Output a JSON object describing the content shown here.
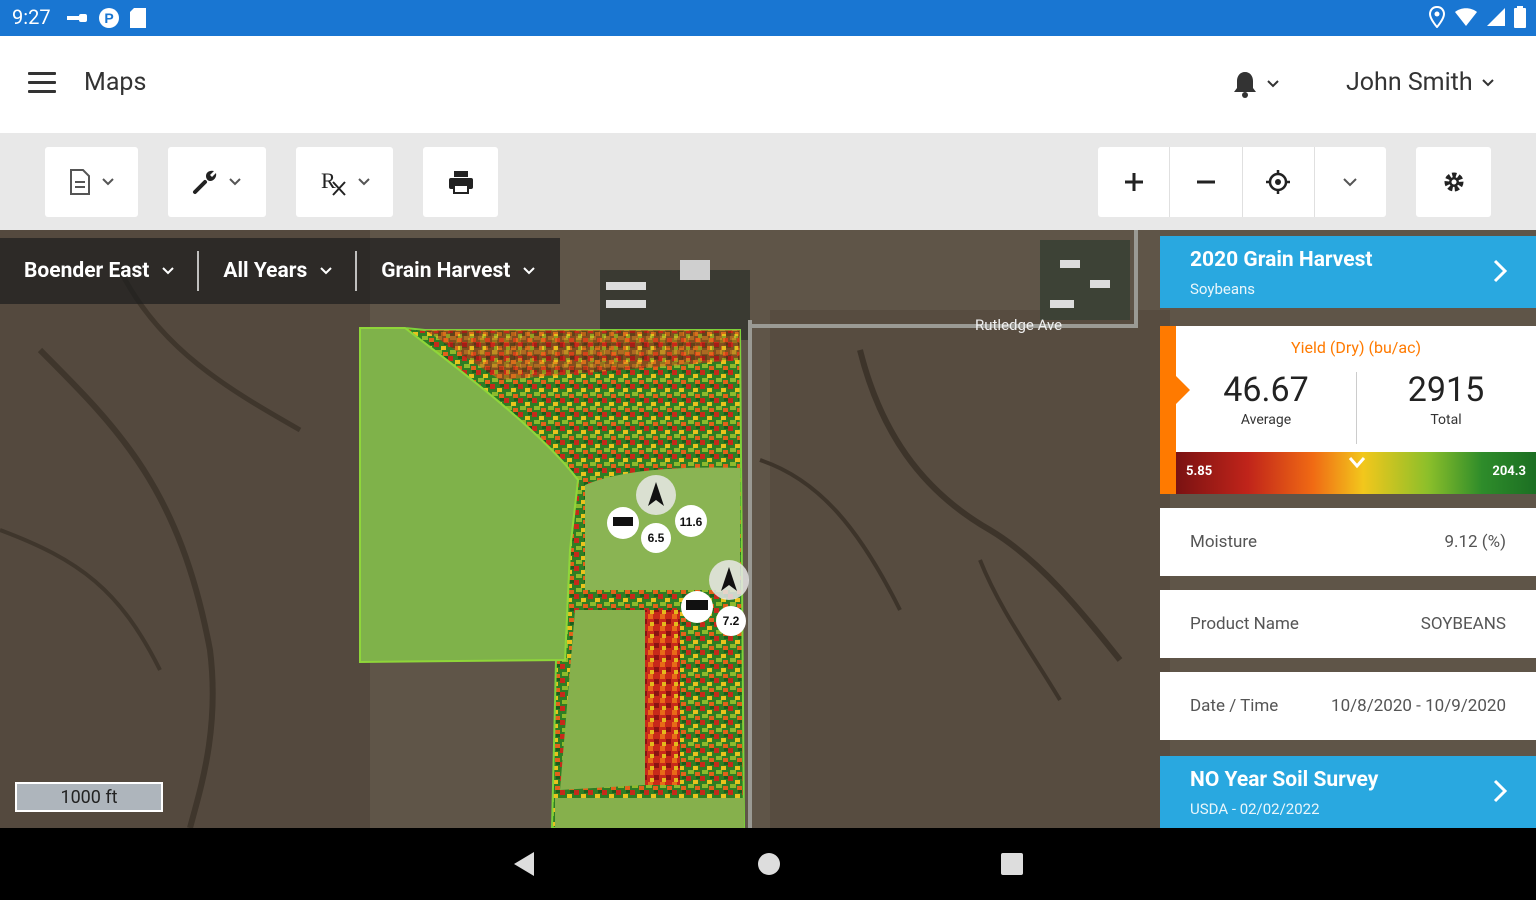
{
  "status_bar": {
    "time": "9:27",
    "icons_left": [
      "key-icon",
      "p-circle-icon",
      "sd-card-icon"
    ],
    "icons_right": [
      "location-icon",
      "wifi-icon",
      "signal-icon",
      "battery-icon"
    ]
  },
  "app_bar": {
    "title": "Maps",
    "user_name": "John Smith"
  },
  "toolbar": {
    "buttons": [
      "document-icon",
      "wrench-icon",
      "rx-icon",
      "print-icon"
    ],
    "zoom_buttons": [
      "zoom-in-icon",
      "zoom-out-icon",
      "locate-icon",
      "chevron-down-icon"
    ],
    "settings": "gear-icon"
  },
  "map": {
    "filters": {
      "field": "Boender East",
      "years": "All Years",
      "operation": "Grain Harvest"
    },
    "road_label": "Rutledge Ave",
    "markers": [
      "11.6",
      "6.5",
      "7.2"
    ],
    "scale_label": "1000 ft"
  },
  "panel": {
    "layer": {
      "title": "2020 Grain Harvest",
      "subtitle": "Soybeans"
    },
    "yield": {
      "title": "Yield (Dry) (bu/ac)",
      "average_value": "46.67",
      "average_label": "Average",
      "total_value": "2915",
      "total_label": "Total",
      "range_min": "5.85",
      "range_max": "204.3",
      "accent_color": "#ff7a00"
    },
    "rows": [
      {
        "key": "Moisture",
        "value": "9.12 (%)"
      },
      {
        "key": "Product Name",
        "value": "SOYBEANS"
      },
      {
        "key": "Date / Time",
        "value": "10/8/2020 - 10/9/2020"
      }
    ],
    "secondary_layer": {
      "title": "NO Year Soil Survey",
      "subtitle": "USDA - 02/02/2022"
    }
  },
  "colors": {
    "status_bar": "#1976d2",
    "layer_card": "#29a8e0",
    "field_green": "#7fb24a"
  }
}
